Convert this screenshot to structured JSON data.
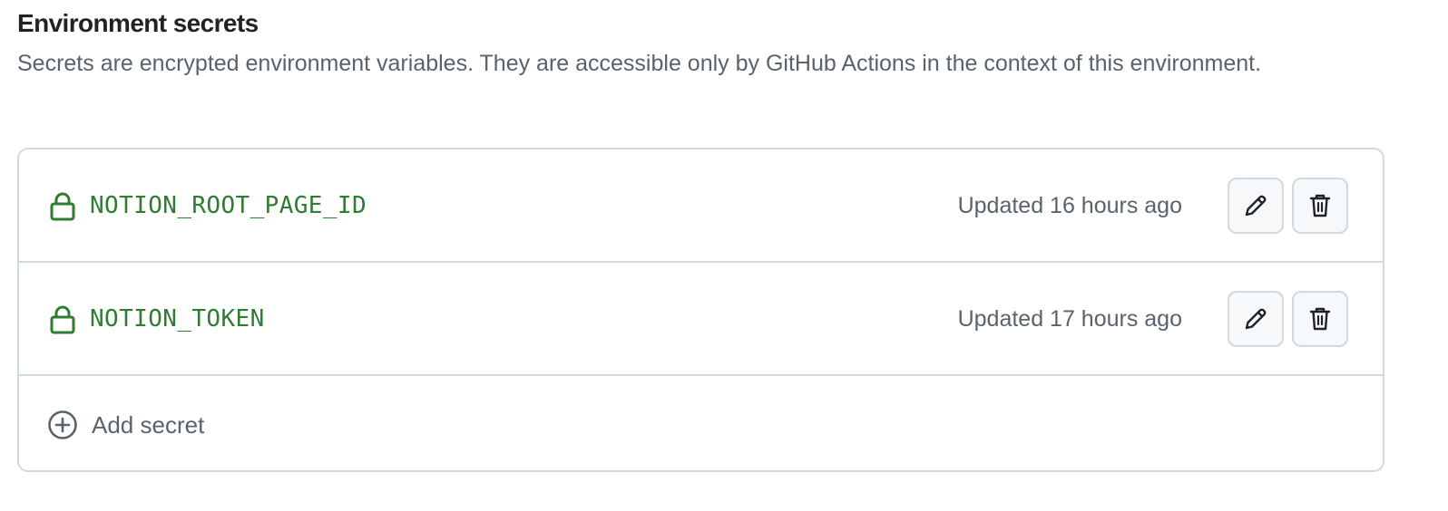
{
  "section": {
    "title": "Environment secrets",
    "description": "Secrets are encrypted environment variables. They are accessible only by GitHub Actions in the context of this environment."
  },
  "secrets": [
    {
      "name": "NOTION_ROOT_PAGE_ID",
      "updated": "Updated 16 hours ago",
      "icon": "lock-icon"
    },
    {
      "name": "NOTION_TOKEN",
      "updated": "Updated 17 hours ago",
      "icon": "lock-icon"
    }
  ],
  "actions": {
    "edit_icon": "pencil-icon",
    "delete_icon": "trash-icon"
  },
  "add_secret": {
    "label": "Add secret",
    "icon": "plus-circle-icon"
  },
  "colors": {
    "secret_name": "#2e7d32",
    "muted_text": "#59636e",
    "border": "#d1d9e0",
    "button_bg": "#f6f8fa"
  }
}
